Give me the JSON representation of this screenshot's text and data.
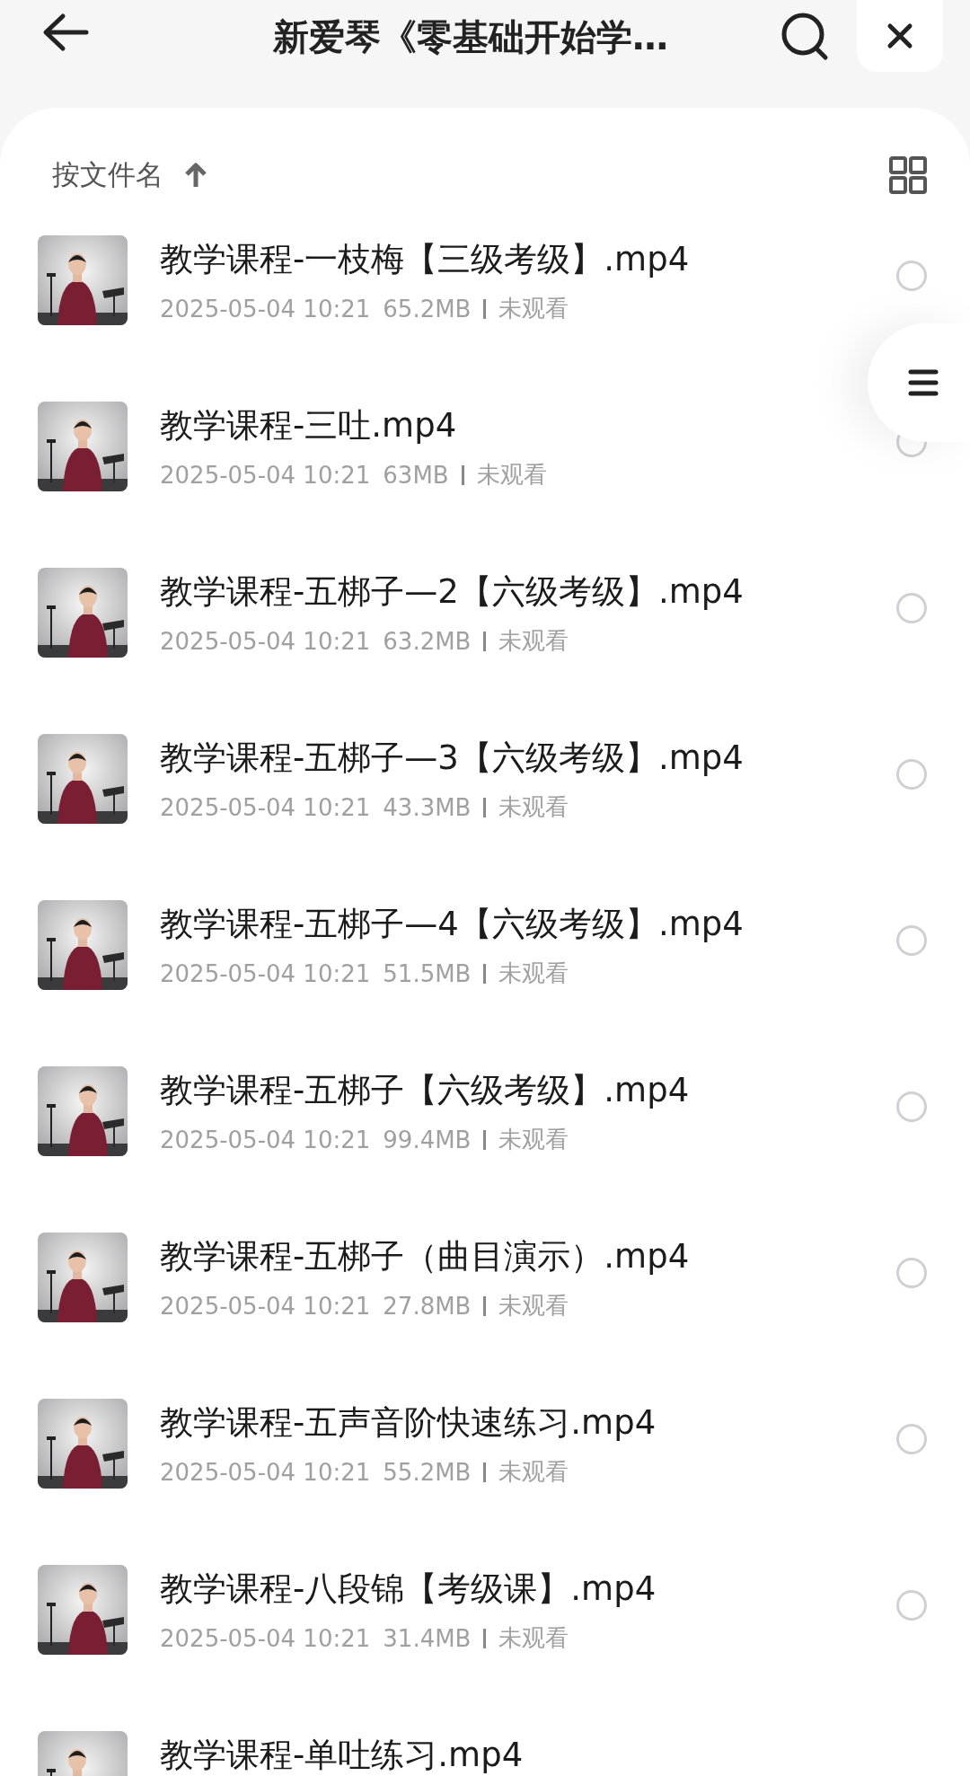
{
  "header": {
    "title": "新爱琴《零基础开始学…"
  },
  "sort": {
    "label": "按文件名"
  },
  "files": [
    {
      "name": "教学课程-一枝梅【三级考级】.mp4",
      "date": "2025-05-04 10:21",
      "size": "65.2MB",
      "status": "未观看",
      "selected": false
    },
    {
      "name": "教学课程-三吐.mp4",
      "date": "2025-05-04 10:21",
      "size": "63MB",
      "status": "未观看",
      "selected": false
    },
    {
      "name": "教学课程-五梆子—2【六级考级】.mp4",
      "date": "2025-05-04 10:21",
      "size": "63.2MB",
      "status": "未观看",
      "selected": false
    },
    {
      "name": "教学课程-五梆子—3【六级考级】.mp4",
      "date": "2025-05-04 10:21",
      "size": "43.3MB",
      "status": "未观看",
      "selected": false
    },
    {
      "name": "教学课程-五梆子—4【六级考级】.mp4",
      "date": "2025-05-04 10:21",
      "size": "51.5MB",
      "status": "未观看",
      "selected": false
    },
    {
      "name": "教学课程-五梆子【六级考级】.mp4",
      "date": "2025-05-04 10:21",
      "size": "99.4MB",
      "status": "未观看",
      "selected": false
    },
    {
      "name": "教学课程-五梆子（曲目演示）.mp4",
      "date": "2025-05-04 10:21",
      "size": "27.8MB",
      "status": "未观看",
      "selected": false
    },
    {
      "name": "教学课程-五声音阶快速练习.mp4",
      "date": "2025-05-04 10:21",
      "size": "55.2MB",
      "status": "未观看",
      "selected": false
    },
    {
      "name": "教学课程-八段锦【考级课】.mp4",
      "date": "2025-05-04 10:21",
      "size": "31.4MB",
      "status": "未观看",
      "selected": false
    },
    {
      "name": "教学课程-单吐练习.mp4"
    }
  ]
}
